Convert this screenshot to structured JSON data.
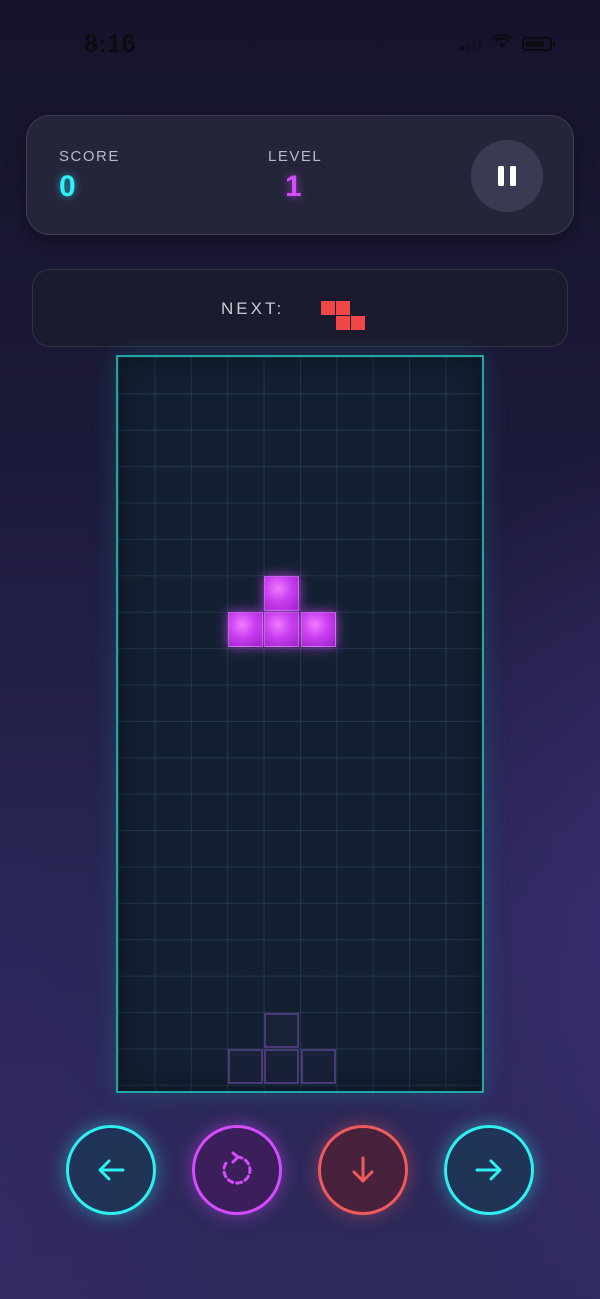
{
  "status_bar": {
    "time": "8:16"
  },
  "stats": {
    "score_label": "SCORE",
    "score": "0",
    "level_label": "LEVEL",
    "level": "1"
  },
  "next": {
    "label": "NEXT:",
    "piece": "Z",
    "color": "#f04848"
  },
  "board": {
    "columns": 10,
    "rows": 20,
    "active_piece": {
      "type": "T",
      "color": "#d54cff",
      "cells": [
        [
          4,
          6
        ],
        [
          3,
          7
        ],
        [
          4,
          7
        ],
        [
          5,
          7
        ]
      ]
    },
    "ghost_piece": {
      "cells": [
        [
          4,
          18
        ],
        [
          3,
          19
        ],
        [
          4,
          19
        ],
        [
          5,
          19
        ]
      ]
    }
  },
  "controls": {
    "left": "arrow-left-icon",
    "rotate": "rotate-icon",
    "drop": "arrow-down-icon",
    "right": "arrow-right-icon"
  },
  "colors": {
    "accent_cyan": "#2ef0f0",
    "accent_purple": "#d54cff",
    "accent_red": "#f05a5a"
  }
}
